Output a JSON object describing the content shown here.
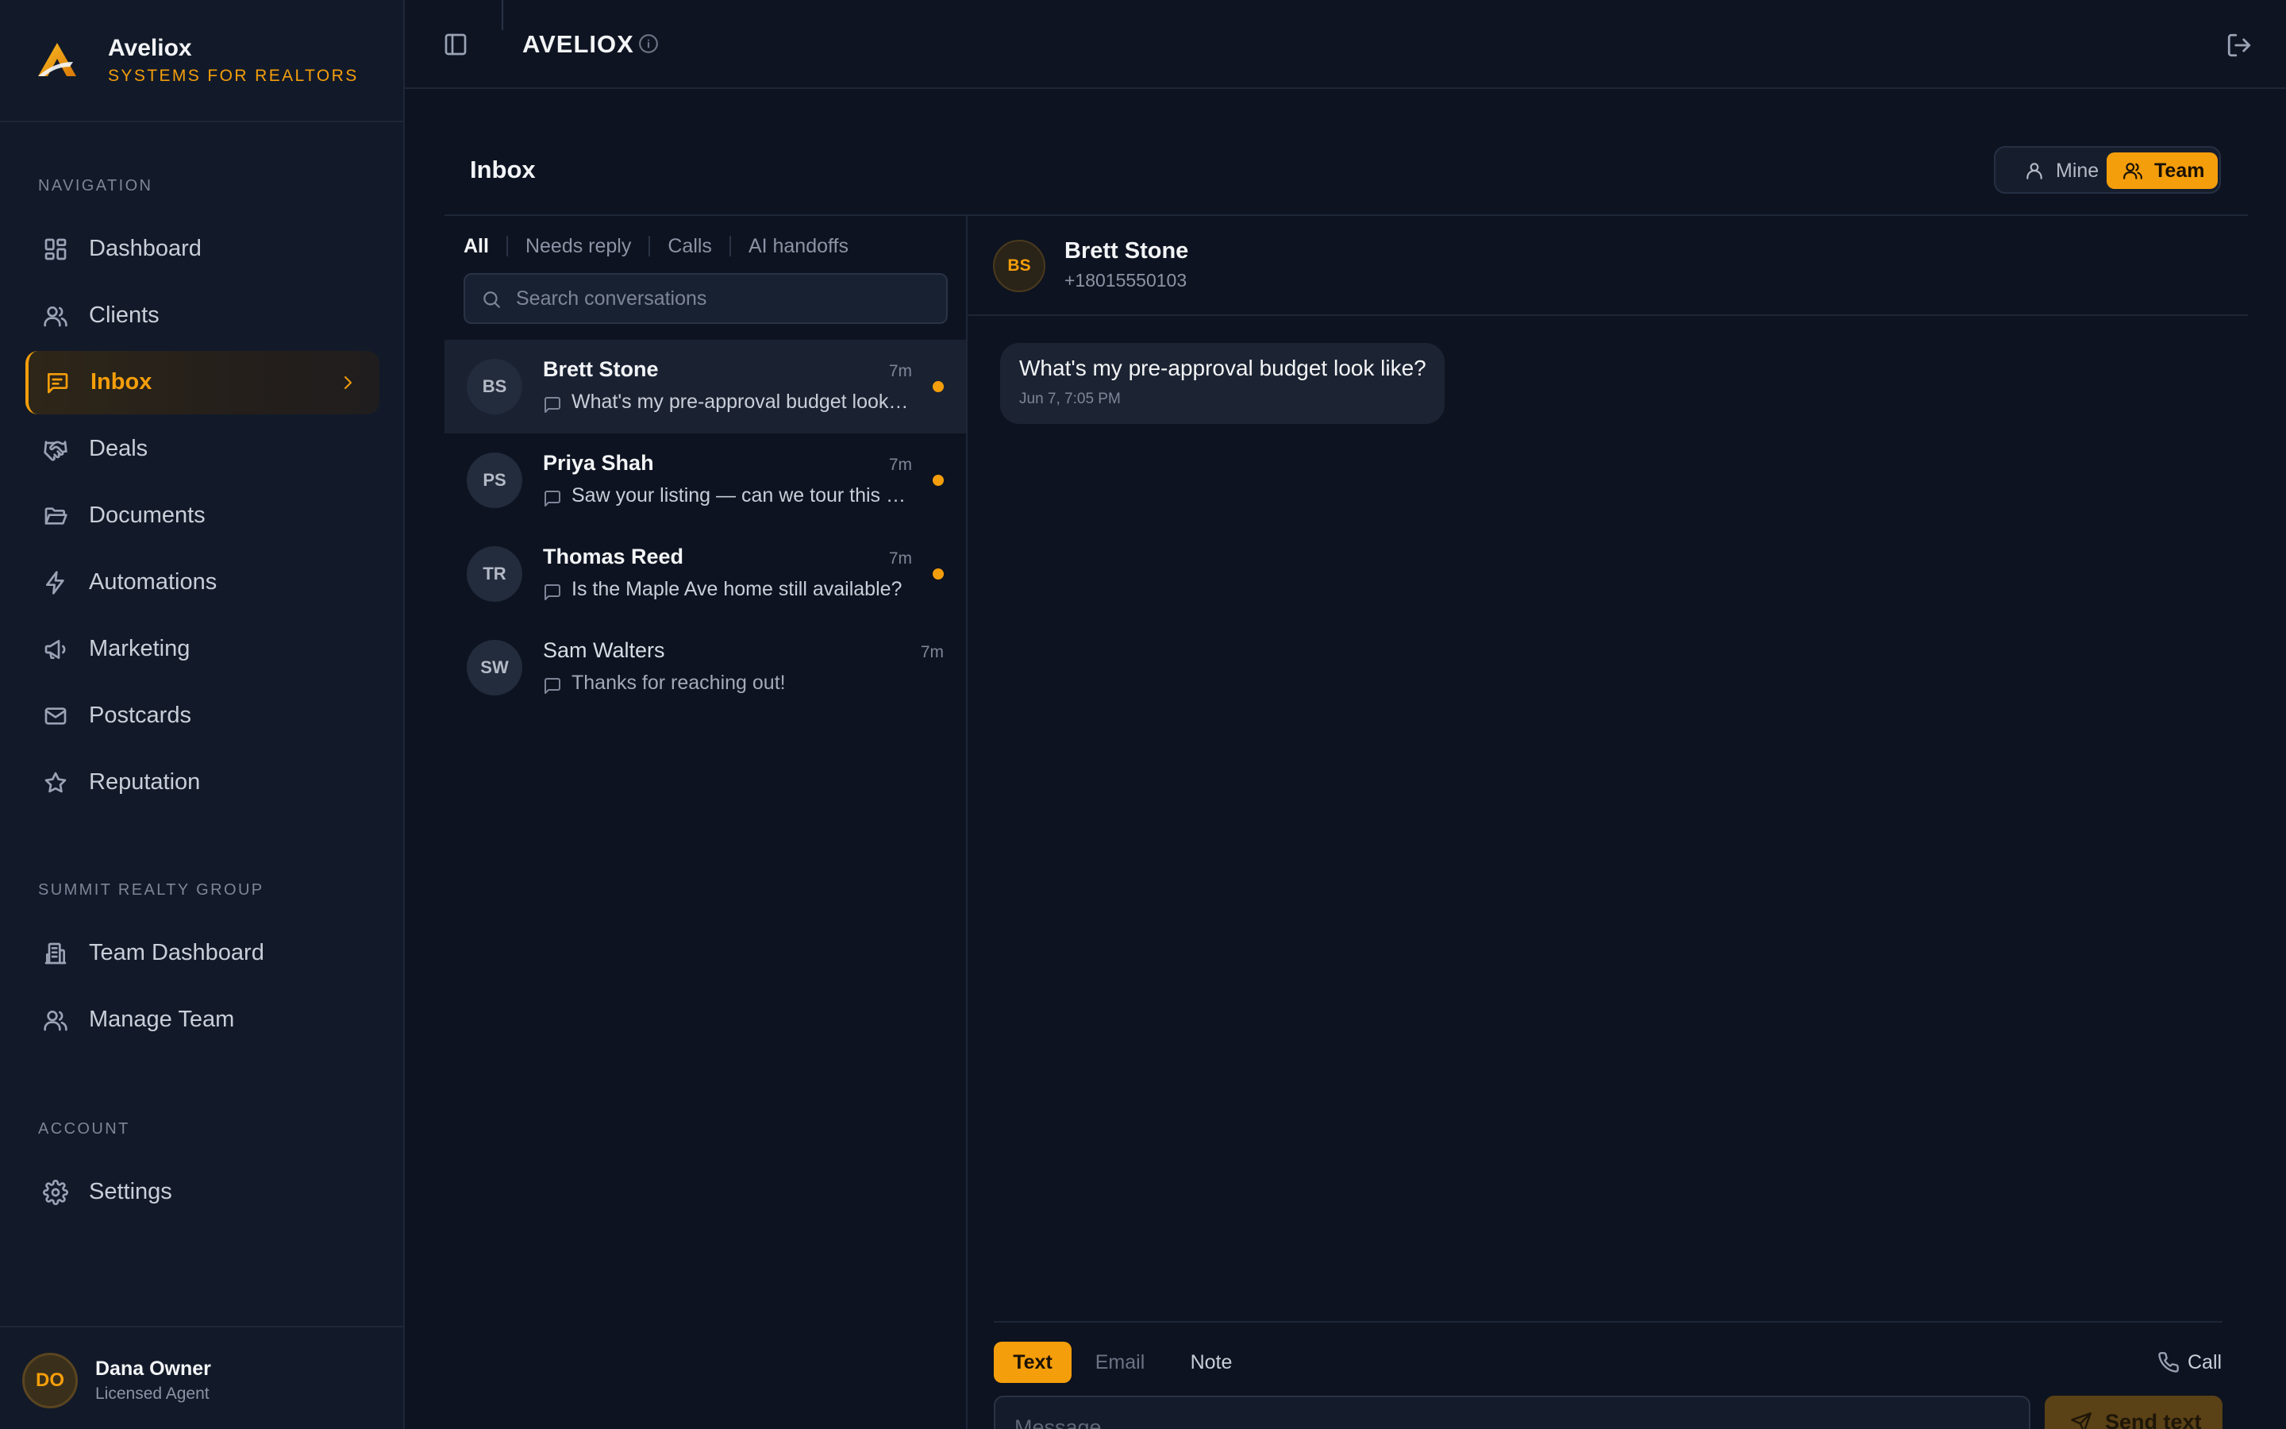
{
  "brand": {
    "name": "Aveliox",
    "tagline": "SYSTEMS FOR REALTORS",
    "accent": "#f59e0b"
  },
  "topbar": {
    "title": "AVELIOX"
  },
  "sidebar": {
    "sections": [
      {
        "label": "NAVIGATION"
      },
      {
        "label": "SUMMIT REALTY GROUP"
      },
      {
        "label": "ACCOUNT"
      }
    ],
    "items": [
      {
        "label": "Dashboard",
        "icon": "grid-icon"
      },
      {
        "label": "Clients",
        "icon": "users-icon"
      },
      {
        "label": "Inbox",
        "icon": "message-icon",
        "active": true
      },
      {
        "label": "Deals",
        "icon": "handshake-icon"
      },
      {
        "label": "Documents",
        "icon": "folder-icon"
      },
      {
        "label": "Automations",
        "icon": "zap-icon"
      },
      {
        "label": "Marketing",
        "icon": "megaphone-icon"
      },
      {
        "label": "Postcards",
        "icon": "mail-icon"
      },
      {
        "label": "Reputation",
        "icon": "star-icon"
      },
      {
        "label": "Team Dashboard",
        "icon": "building-icon"
      },
      {
        "label": "Manage Team",
        "icon": "users-icon"
      },
      {
        "label": "Settings",
        "icon": "gear-icon"
      }
    ],
    "user": {
      "initials": "DO",
      "name": "Dana Owner",
      "role": "Licensed Agent"
    }
  },
  "inbox": {
    "title": "Inbox",
    "scope": {
      "mine": "Mine",
      "team": "Team",
      "selected": "Team"
    },
    "filters": [
      "All",
      "Needs reply",
      "Calls",
      "AI handoffs"
    ],
    "active_filter": "All",
    "search_placeholder": "Search conversations",
    "conversations": [
      {
        "initials": "BS",
        "name": "Brett Stone",
        "time": "7m",
        "preview": "What's my pre-approval budget look like?",
        "unread": true,
        "selected": true
      },
      {
        "initials": "PS",
        "name": "Priya Shah",
        "time": "7m",
        "preview": "Saw your listing — can we tour this weekend?",
        "unread": true
      },
      {
        "initials": "TR",
        "name": "Thomas Reed",
        "time": "7m",
        "preview": "Is the Maple Ave home still available?",
        "unread": true
      },
      {
        "initials": "SW",
        "name": "Sam Walters",
        "time": "7m",
        "preview": "Thanks for reaching out!",
        "unread": false
      }
    ]
  },
  "thread": {
    "initials": "BS",
    "name": "Brett Stone",
    "phone": "+18015550103",
    "messages": [
      {
        "text": "What's my pre-approval budget look like?",
        "time": "Jun 7, 7:05 PM"
      }
    ],
    "composer": {
      "tabs": [
        "Text",
        "Email",
        "Note"
      ],
      "active_tab": "Text",
      "call_label": "Call",
      "placeholder": "Message",
      "send_label": "Send text"
    }
  }
}
